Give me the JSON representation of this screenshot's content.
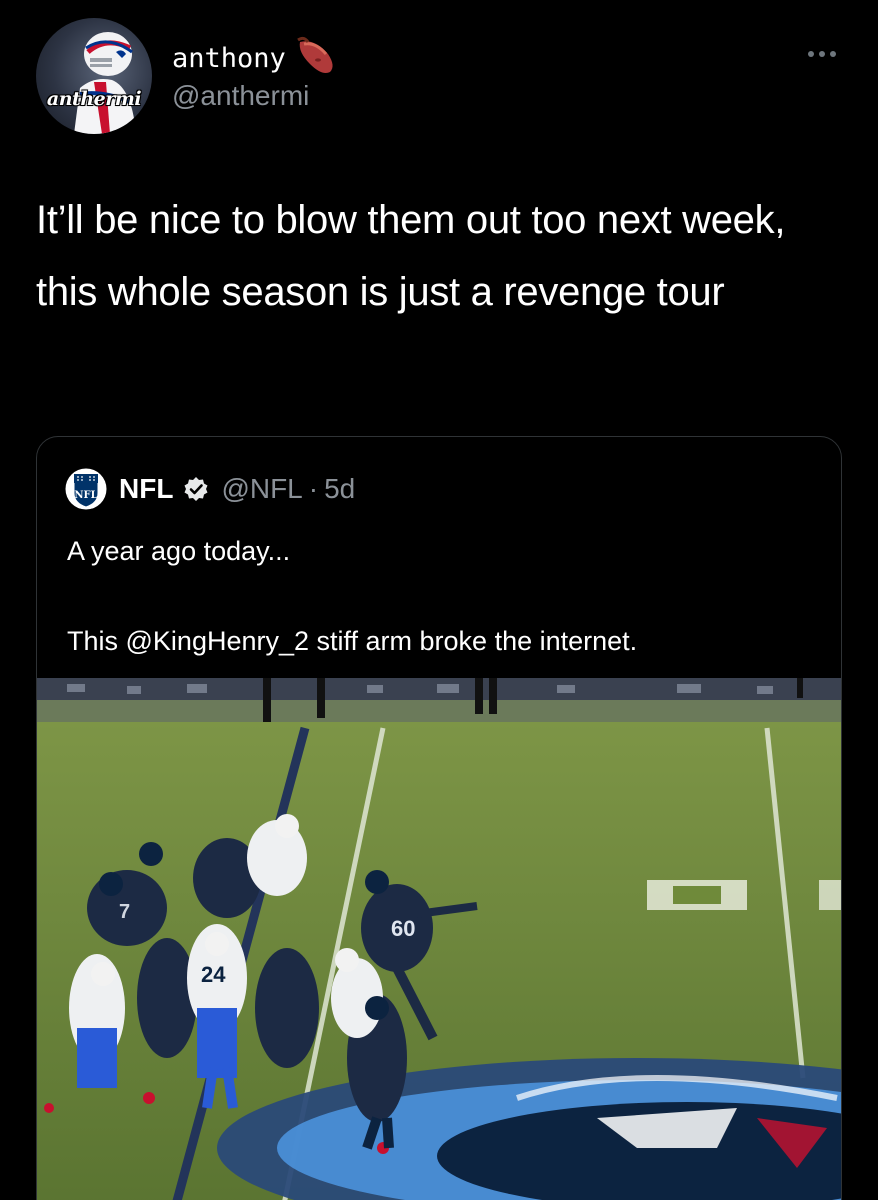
{
  "tweet": {
    "author": {
      "display_name": "anthony",
      "name_emoji": "sweet-potato-icon",
      "handle": "@anthermi",
      "avatar_text": "anthermi"
    },
    "text": "It’ll be nice to blow them out too next week, this whole season is just a revenge tour",
    "more_icon": "more-horizontal-icon"
  },
  "quoted_tweet": {
    "author": {
      "display_name": "NFL",
      "verified": true,
      "handle": "@NFL",
      "separator": "·",
      "time": "5d",
      "avatar_icon": "nfl-shield-logo",
      "avatar_text": "NFL"
    },
    "text": "A year ago today...\n\nThis @KingHenry_2 stiff arm broke the internet.",
    "media": {
      "type": "video-still",
      "jersey_numbers": [
        "60",
        "24",
        "7"
      ]
    }
  },
  "colors": {
    "background": "#000000",
    "primary_text": "#ffffff",
    "secondary_text": "#8b9198",
    "card_border": "#2f3336",
    "field_green": "#6f8a3a",
    "titans_navy": "#1c2a44",
    "bills_red": "#c8102e"
  }
}
